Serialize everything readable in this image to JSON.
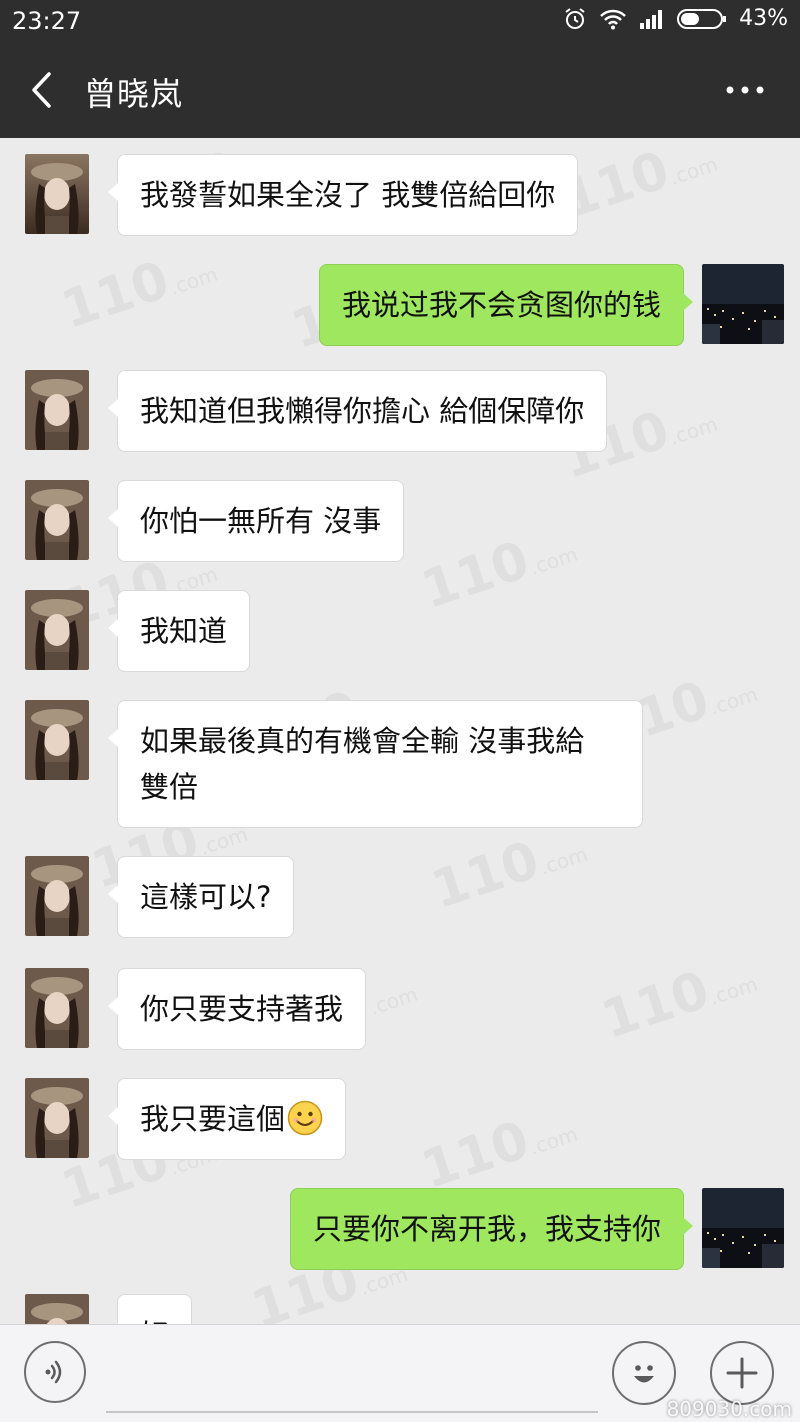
{
  "status_bar": {
    "time": "23:27",
    "battery": "43%"
  },
  "header": {
    "title": "曾晓岚",
    "back_icon": "chevron-left-icon",
    "more_icon": "more-horizontal-icon"
  },
  "messages": [
    {
      "side": "in",
      "text": "我發誓如果全沒了 我雙倍給回你"
    },
    {
      "side": "out",
      "text": "我说过我不会贪图你的钱"
    },
    {
      "side": "in",
      "text": "我知道但我懶得你擔心 給個保障你"
    },
    {
      "side": "in",
      "text": "你怕一無所有 沒事"
    },
    {
      "side": "in",
      "text": "我知道"
    },
    {
      "side": "in",
      "text_line1": "如果最後真的有機會全輸 沒事我給",
      "text_line2": "雙倍"
    },
    {
      "side": "in",
      "text": "這樣可以?"
    },
    {
      "side": "in",
      "text": "你只要支持著我"
    },
    {
      "side": "in",
      "text": "我只要這個",
      "emoji": "smiley-emoji"
    },
    {
      "side": "out",
      "text": "只要你不离开我，我支持你"
    },
    {
      "side": "in",
      "text": "好"
    }
  ],
  "watermark": {
    "text": "110",
    "suffix": ".com"
  },
  "input_bar": {
    "voice_icon": "voice-icon",
    "emoji_icon": "smiley-icon",
    "plus_icon": "plus-icon",
    "value": ""
  },
  "corner_mark": "809030.com",
  "colors": {
    "header_bg": "#2e2e2e",
    "chat_bg": "#ebebeb",
    "bubble_out": "#9fe75e",
    "bubble_in": "#ffffff"
  }
}
